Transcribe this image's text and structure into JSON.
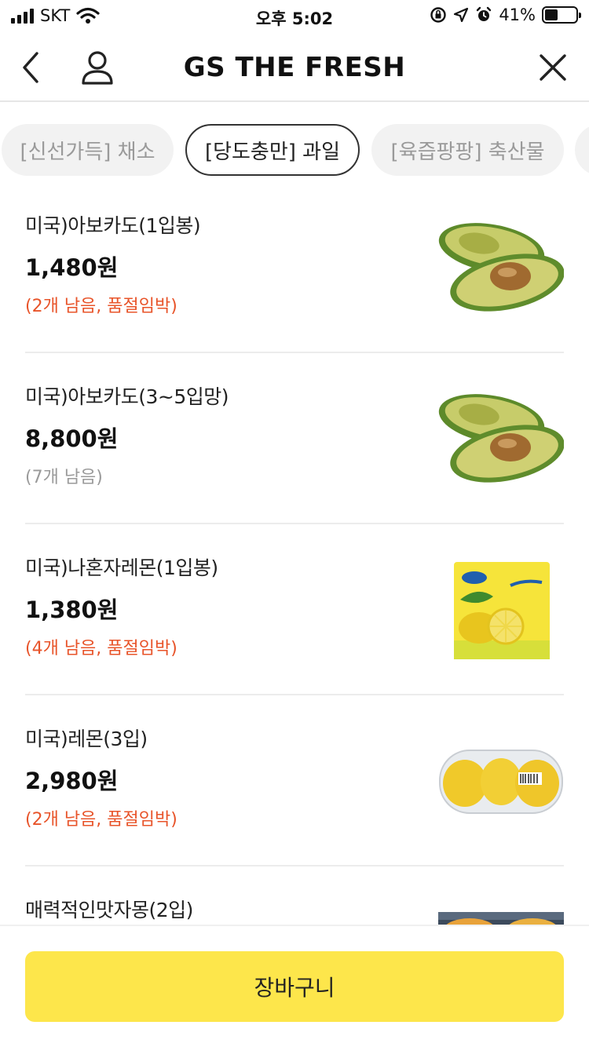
{
  "status_bar": {
    "carrier": "SKT",
    "time": "오후 5:02",
    "battery": "41%",
    "battery_level": 0.41
  },
  "header": {
    "title": "GS THE FRESH",
    "icons": [
      "back-icon",
      "user-icon",
      "close-icon"
    ]
  },
  "tabs": [
    {
      "label": "[신선가득] 채소",
      "active": false
    },
    {
      "label": "[당도충만] 과일",
      "active": true
    },
    {
      "label": "[육즙팡팡] 축산물",
      "active": false
    }
  ],
  "products": [
    {
      "name": "미국)아보카도(1입봉)",
      "price": "1,480원",
      "stock": "(2개 남음, 품절임박)",
      "stock_status": "warn",
      "image": "avocado"
    },
    {
      "name": "미국)아보카도(3~5입망)",
      "price": "8,800원",
      "stock": "(7개 남음)",
      "stock_status": "normal",
      "image": "avocado"
    },
    {
      "name": "미국)나혼자레몬(1입봉)",
      "price": "1,380원",
      "stock": "(4개 남음, 품절임박)",
      "stock_status": "warn",
      "image": "lemon-bag"
    },
    {
      "name": "미국)레몬(3입)",
      "price": "2,980원",
      "stock": "(2개 남음, 품절임박)",
      "stock_status": "warn",
      "image": "lemon-pack"
    },
    {
      "name": "매력적인맛자몽(2입)",
      "price": "",
      "stock": "",
      "stock_status": "warn",
      "image": "grapefruit-pack"
    }
  ],
  "bottom": {
    "cart_label": "장바구니"
  },
  "colors": {
    "accent": "#fde64b",
    "warn": "#e8542a",
    "muted": "#9a9a9a"
  }
}
